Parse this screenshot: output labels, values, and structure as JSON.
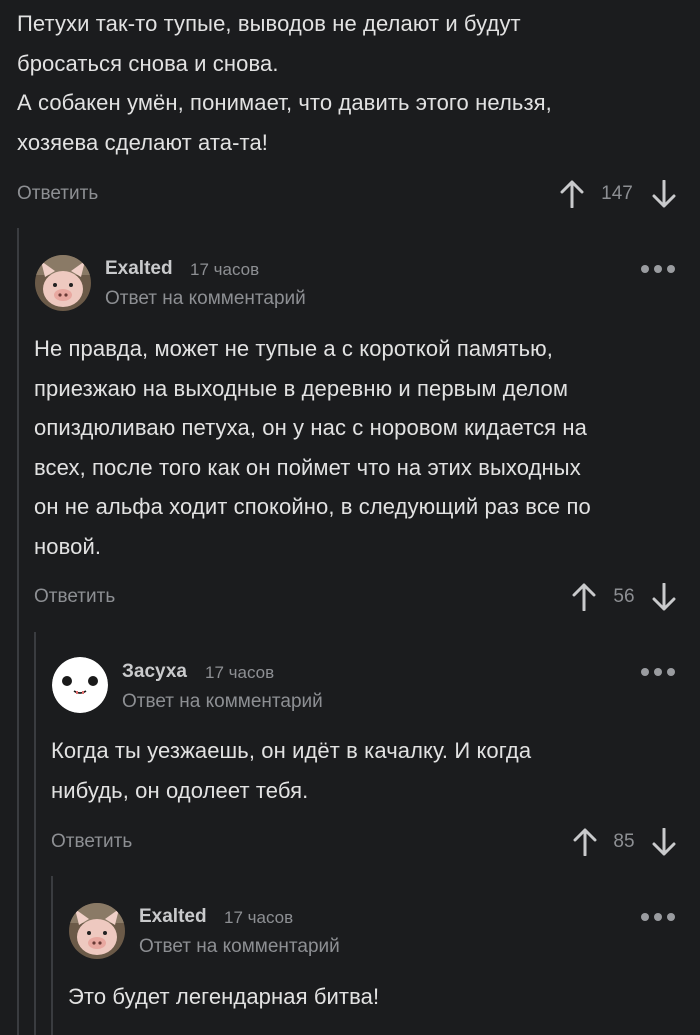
{
  "comments": [
    {
      "lines": [
        "Петухи так-то тупые, выводов не делают и будут",
        "бросаться снова и снова.",
        "А собакен умён, понимает, что давить этого нельзя,",
        "хозяева сделают ата-та!"
      ],
      "reply_label": "Ответить",
      "rating": "147"
    },
    {
      "username": "Exalted",
      "time": "17 часов",
      "reply_to": "Ответ на комментарий",
      "lines": [
        "Не правда, может не тупые а с короткой памятью,",
        "приезжаю на выходные в деревню и первым делом",
        "опиздюливаю петуха, он у нас с норовом кидается на",
        "всех, после того как он поймет что на этих выходных",
        "он не альфа ходит спокойно, в следующий раз все по",
        "новой."
      ],
      "reply_label": "Ответить",
      "rating": "56"
    },
    {
      "username": "Засуха",
      "time": "17 часов",
      "reply_to": "Ответ на комментарий",
      "lines": [
        "Когда ты уезжаешь, он идёт в качалку. И когда",
        "нибудь, он одолеет тебя."
      ],
      "reply_label": "Ответить",
      "rating": "85"
    },
    {
      "username": "Exalted",
      "time": "17 часов",
      "reply_to": "Ответ на комментарий",
      "lines": [
        "Это будет легендарная битва!"
      ]
    }
  ],
  "icons": {
    "vote_up": "arrow-up-icon",
    "vote_down": "arrow-down-icon",
    "more": "more-dots-icon"
  },
  "colors": {
    "background": "#1b1c1e",
    "text": "#e2e2e2",
    "muted": "#8d8f93"
  }
}
